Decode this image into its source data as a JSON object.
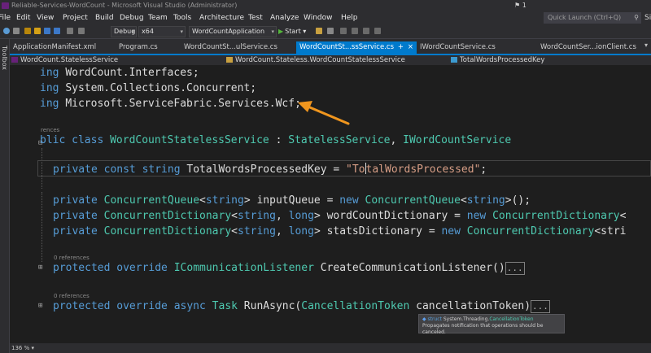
{
  "window": {
    "title": "Reliable-Services-WordCount - Microsoft Visual Studio (Administrator)",
    "notification_count": "1"
  },
  "menu": {
    "items": [
      "File",
      "Edit",
      "View",
      "Project",
      "Build",
      "Debug",
      "Team",
      "Tools",
      "Architecture",
      "Test",
      "Analyze",
      "Window",
      "Help"
    ],
    "quick_launch_placeholder": "Quick Launch (Ctrl+Q)",
    "sign_in": "Sign"
  },
  "toolbar": {
    "configuration": "Debug",
    "platform": "x64",
    "startup_project": "WordCountApplication",
    "start_label": "Start"
  },
  "toolbox_label": "Toolbox",
  "tabs": [
    {
      "label": "ApplicationManifest.xml"
    },
    {
      "label": "Program.cs"
    },
    {
      "label": "WordCountSt...ulService.cs"
    },
    {
      "label": "WordCountSt...ssService.cs",
      "close": "×",
      "pin": "+"
    },
    {
      "label": "IWordCountService.cs"
    },
    {
      "label": "WordCountSer...ionClient.cs"
    }
  ],
  "navbar": {
    "project": "WordCount.StatelessService",
    "type": "WordCount.Stateless.WordCountStatelessService",
    "member": "TotalWordsProcessedKey"
  },
  "code": {
    "l1": {
      "a": "ing ",
      "b": "WordCount.Interfaces;"
    },
    "l2": {
      "a": "ing ",
      "b": "System.Collections.Concurrent;"
    },
    "l3": {
      "a": "ing ",
      "b": "Microsoft.ServiceFabric.Services.Wcf;"
    },
    "lens1": "rences",
    "l4": {
      "a": "blic class ",
      "b": "WordCountStatelessService",
      "c": " : ",
      "d": "StatelessService",
      "e": ", ",
      "f": "IWordCountService"
    },
    "l5": {
      "a": "private const string ",
      "b": "TotalWordsProcessedKey = ",
      "c": "\"To",
      "d": "talWordsProcessed\"",
      "e": ";"
    },
    "l6": {
      "a": "private ",
      "b": "ConcurrentQueue",
      "c": "<",
      "d": "string",
      "e": "> inputQueue = ",
      "f": "new ",
      "g": "ConcurrentQueue",
      "h": "<",
      "i": "string",
      "j": ">();"
    },
    "l7": {
      "a": "private ",
      "b": "ConcurrentDictionary",
      "c": "<",
      "d": "string",
      "e": ", ",
      "f": "long",
      "g": "> wordCountDictionary = ",
      "h": "new ",
      "i": "ConcurrentDictionary",
      "j": "<"
    },
    "l8": {
      "a": "private ",
      "b": "ConcurrentDictionary",
      "c": "<",
      "d": "string",
      "e": ", ",
      "f": "long",
      "g": "> statsDictionary = ",
      "h": "new ",
      "i": "ConcurrentDictionary",
      "j": "<stri"
    },
    "lens2": "0 references",
    "l9": {
      "a": "protected override ",
      "b": "ICommunicationListener",
      "c": " CreateCommunicationListener()",
      "d": "..."
    },
    "lens3": "0 references",
    "l10": {
      "a": "protected override async ",
      "b": "Task",
      "c": " RunAsync(",
      "d": "CancellationToke",
      "e": "n",
      "f": " cancellationToken)",
      "g": "..."
    }
  },
  "tooltip": {
    "kind": "struct",
    "ns": "System.Threading.",
    "type": "CancellationToken",
    "desc": "Propagates notification that operations should be canceled."
  },
  "status": {
    "zoom": "136 %"
  }
}
